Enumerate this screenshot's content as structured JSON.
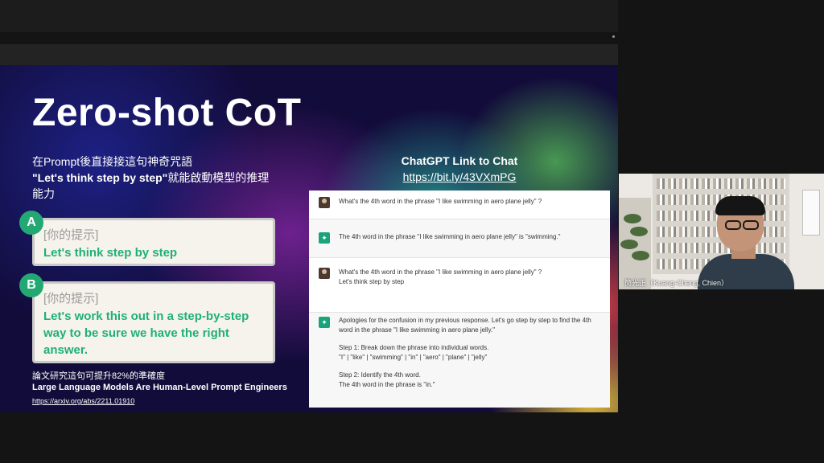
{
  "slide": {
    "title": "Zero-shot CoT",
    "intro_line1": "在Prompt後直接接這句神奇咒語",
    "intro_line2_quote": "\"Let's think step by step\"",
    "intro_line2_rest": "就能啟動模型的推理",
    "intro_line3": "能力",
    "card_a": {
      "badge": "A",
      "hint": "[你的提示]",
      "prompt": "Let's think step by step"
    },
    "card_b": {
      "badge": "B",
      "hint": "[你的提示]",
      "prompt": "Let's work this out in a step-by-step way to be sure we have the right answer."
    },
    "note_accuracy": "論文研究這句可提升82%的準確度",
    "paper_title": "Large Language Models Are Human-Level Prompt Engineers",
    "paper_link": "https://arxiv.org/abs/2211.01910",
    "chat_heading": "ChatGPT Link to Chat",
    "chat_link": "https://bit.ly/43VXmPG"
  },
  "chat": {
    "msg1": "What's the 4th word in the phrase \"I like swimming in aero plane jelly\" ?",
    "msg2": "The 4th word in the phrase \"I like swimming in aero plane jelly\" is \"swimming.\"",
    "msg3_line1": "What's the 4th word in the phrase \"I like swimming in aero plane jelly\" ?",
    "msg3_line2": "Let's think step by step",
    "msg4_para1": "Apologies for the confusion in my previous response. Let's go step by step to find the 4th word in the phrase \"I like swimming in aero plane jelly.\"",
    "msg4_step1": "Step 1: Break down the phrase into individual words.",
    "msg4_words": "\"I\" | \"like\" | \"swimming\" | \"in\" | \"aero\" | \"plane\" | \"jelly\"",
    "msg4_step2": "Step 2: Identify the 4th word.",
    "msg4_answer": "The 4th word in the phrase is \"in.\""
  },
  "video": {
    "participant_name": "簡光正（Kuang-Cheng, Chien）"
  }
}
